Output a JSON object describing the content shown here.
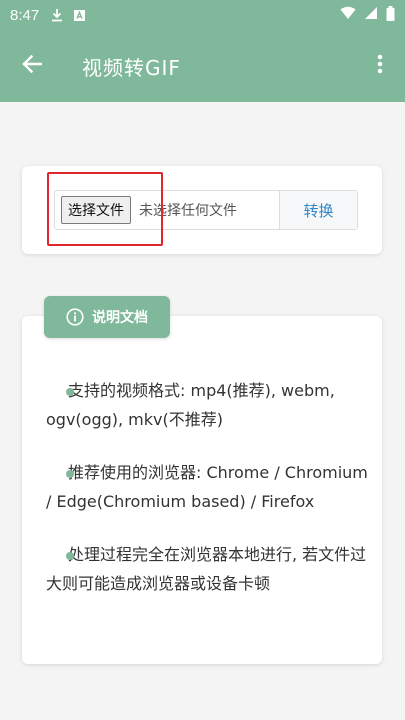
{
  "status_bar": {
    "time": "8:47"
  },
  "app_bar": {
    "title": "视频转GIF"
  },
  "file_card": {
    "choose_label": "选择文件",
    "file_status": "未选择任何文件",
    "convert_label": "转换"
  },
  "doc": {
    "badge_label": "说明文档",
    "items": [
      "支持的视频格式: mp4(推荐), webm, ogv(ogg), mkv(不推荐)",
      "推荐使用的浏览器: Chrome / Chromium / Edge(Chromium based) / Firefox",
      "处理过程完全在浏览器本地进行, 若文件过大则可能造成浏览器或设备卡顿"
    ]
  },
  "colors": {
    "accent": "#7fb89a",
    "link": "#2f87c8",
    "highlight": "#e0282c"
  }
}
